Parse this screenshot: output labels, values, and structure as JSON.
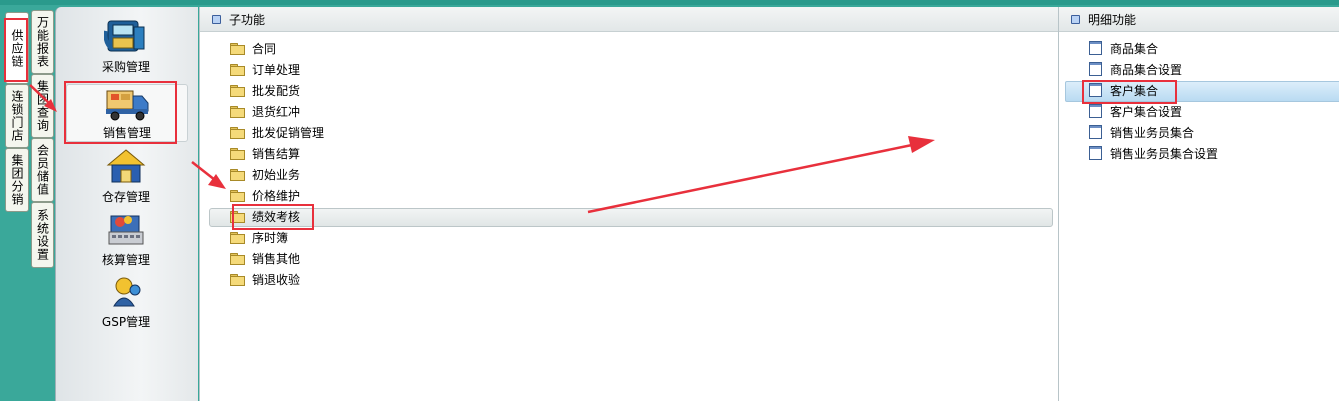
{
  "tabs_left": [
    {
      "label": "供应链",
      "active": true
    },
    {
      "label": "连锁门店",
      "active": false
    },
    {
      "label": "集团分销",
      "active": false
    }
  ],
  "tabs_right": [
    {
      "label": "万能报表"
    },
    {
      "label": "集团查询"
    },
    {
      "label": "会员储值"
    },
    {
      "label": "系统设置"
    }
  ],
  "modules": [
    {
      "label": "采购管理",
      "icon": "purchase-icon"
    },
    {
      "label": "销售管理",
      "icon": "sales-truck-icon",
      "selected": true
    },
    {
      "label": "仓存管理",
      "icon": "warehouse-icon"
    },
    {
      "label": "核算管理",
      "icon": "accounting-icon"
    },
    {
      "label": "GSP管理",
      "icon": "gsp-icon"
    }
  ],
  "subfunctions": {
    "title": "子功能",
    "items": [
      "合同",
      "订单处理",
      "批发配货",
      "退货红冲",
      "批发促销管理",
      "销售结算",
      "初始业务",
      "价格维护",
      "绩效考核",
      "序时簿",
      "销售其他",
      "销退收验"
    ],
    "selected": "绩效考核"
  },
  "details": {
    "title": "明细功能",
    "items": [
      "商品集合",
      "商品集合设置",
      "客户集合",
      "客户集合设置",
      "销售业务员集合",
      "销售业务员集合设置"
    ],
    "selected": "客户集合"
  },
  "colors": {
    "frame": "#3aa89a",
    "highlight_red": "#e8303c",
    "selection_blue": "#b9dbf2"
  }
}
